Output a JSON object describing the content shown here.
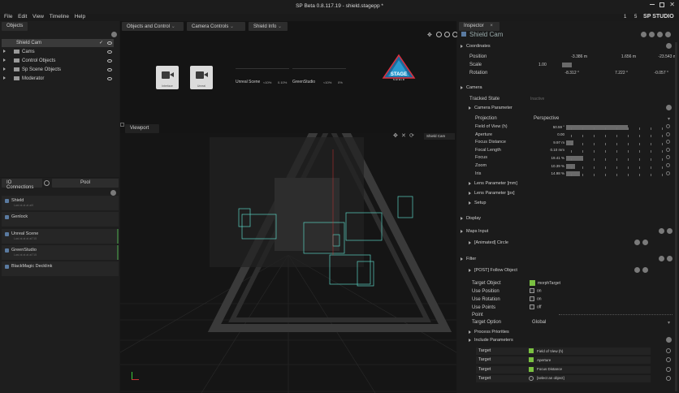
{
  "window": {
    "title": "SP Beta 0.8.117.19 - shield.stagepp *"
  },
  "menu": [
    "File",
    "Edit",
    "View",
    "Timeline",
    "Help"
  ],
  "brand": {
    "badge1": "1",
    "badge2": "5",
    "studio": "SP STUDIO"
  },
  "objects_panel": {
    "tab": "Objects",
    "items": [
      {
        "label": "Shield Cam",
        "selected": true
      },
      {
        "label": "Cams"
      },
      {
        "label": "Control Objects"
      },
      {
        "label": "Sp Scene Objects"
      },
      {
        "label": "Moderator"
      }
    ]
  },
  "io_panel": {
    "tabs": [
      "IO Connections",
      "Pool"
    ],
    "items": [
      {
        "name": "Shield",
        "sub": "Last at at at at9"
      },
      {
        "name": "Genlock",
        "sub": ""
      },
      {
        "name": "Unreal Scene",
        "sub": "Last at at at at715"
      },
      {
        "name": "GreenStudio",
        "sub": "Last at at at at715"
      },
      {
        "name": "BlackMagic Decklink",
        "sub": ""
      }
    ]
  },
  "center_tabs": [
    "Objects and Control",
    "Camera Controls",
    "Shield Info"
  ],
  "center_cams": [
    {
      "label": "Interface"
    },
    {
      "label": "Unreal"
    }
  ],
  "center_stats": [
    {
      "name": "Unreal Scene",
      "a": "<10%",
      "b": "0.10%"
    },
    {
      "name": "GreenStudio",
      "a": "<10%",
      "b": "0%"
    }
  ],
  "logo": {
    "text": "STAGE",
    "sub": "S H I E L D"
  },
  "viewport": {
    "tab": "Viewport",
    "cam_label": "Shield Cam"
  },
  "inspector": {
    "tab": "Inspector",
    "object": "Shield Cam",
    "coordinates": {
      "title": "Coordinates",
      "position": {
        "label": "Position",
        "x": "-3.386 m",
        "y": "1.656 m",
        "z": "-23.543 m"
      },
      "scale": {
        "label": "Scale",
        "v": "1.00"
      },
      "rotation": {
        "label": "Rotation",
        "x": "-8.312 °",
        "y": "7.222 °",
        "z": "-0.057 °"
      }
    },
    "camera": {
      "title": "Camera",
      "tracked_state": {
        "label": "Tracked State",
        "value": "Inactive"
      },
      "params_title": "Camera Parameter",
      "projection": {
        "label": "Projection",
        "value": "Perspective"
      },
      "rows": [
        {
          "label": "Field of View (h)",
          "value": "50.59 °",
          "fill": 0.68
        },
        {
          "label": "Aperture",
          "value": "0.00",
          "fill": 0.0
        },
        {
          "label": "Focus Distance",
          "value": "9.97 m",
          "fill": 0.08
        },
        {
          "label": "Focal Length",
          "value": "0.10 mm",
          "fill": 0.0
        },
        {
          "label": "Focus",
          "value": "19.41 %",
          "fill": 0.19
        },
        {
          "label": "Zoom",
          "value": "10.39 %",
          "fill": 0.1
        },
        {
          "label": "Iris",
          "value": "14.98 %",
          "fill": 0.15
        }
      ],
      "subsections": [
        "Lens Parameter [mm]",
        "Lens Parameter [px]",
        "Setup"
      ]
    },
    "display": "Display",
    "maps_input": {
      "title": "Maps Input",
      "item": "[Animated] Circle"
    },
    "filter": {
      "title": "Filter",
      "item": "[POST] Follow Object",
      "target_object": {
        "label": "Target Object",
        "value": "morphTarget"
      },
      "use_position": {
        "label": "Use Position",
        "value": "on"
      },
      "use_rotation": {
        "label": "Use Rotation",
        "value": "on"
      },
      "use_points": {
        "label": "Use Points",
        "value": "off"
      },
      "point": {
        "label": "Point"
      },
      "target_option": {
        "label": "Target Option",
        "value": "Global"
      },
      "process_priorities": "Process Priorities",
      "include_params": "Include Parameters",
      "targets": [
        {
          "label": "Target",
          "value": "Field of View (h)"
        },
        {
          "label": "Target",
          "value": "Aperture"
        },
        {
          "label": "Target",
          "value": "Focus Distance"
        },
        {
          "label": "Target",
          "value": "[select an object]"
        }
      ]
    }
  }
}
